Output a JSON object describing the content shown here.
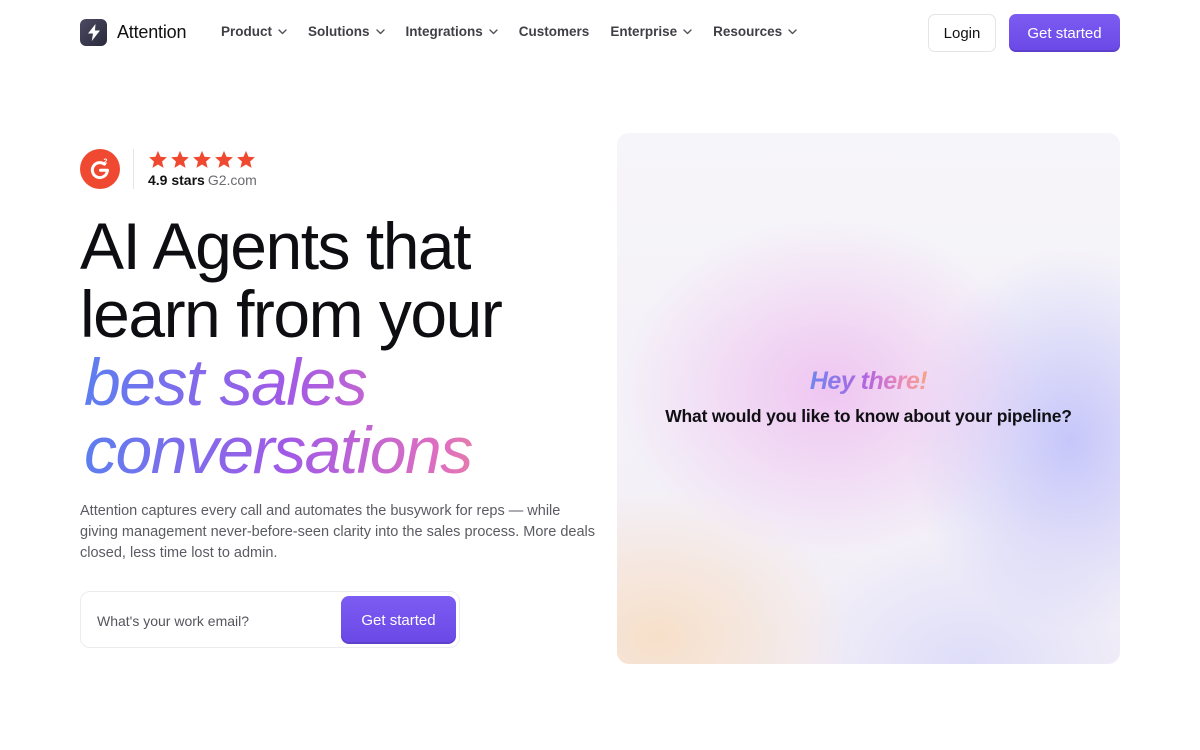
{
  "nav": {
    "brand_name": "Attention",
    "menu": [
      {
        "label": "Product",
        "has_dropdown": true
      },
      {
        "label": "Solutions",
        "has_dropdown": true
      },
      {
        "label": "Integrations",
        "has_dropdown": true
      },
      {
        "label": "Customers",
        "has_dropdown": false
      },
      {
        "label": "Enterprise",
        "has_dropdown": true
      },
      {
        "label": "Resources",
        "has_dropdown": true
      }
    ],
    "login_label": "Login",
    "cta_label": "Get started"
  },
  "rating": {
    "stars": 5,
    "value": "4.9 stars",
    "source": "G2.com",
    "badge_color": "#ef4a31",
    "star_color": "#ef4a31"
  },
  "hero": {
    "headline_line1": "AI Agents that",
    "headline_line2": "learn from your",
    "headline_line3": "best sales",
    "headline_line4": "conversations",
    "description": "Attention captures every call and automates the busywork for reps — while giving management never-before-seen clarity into the sales process. More deals closed, less time lost to admin.",
    "email_placeholder": "What's your work email?",
    "email_button_label": "Get started"
  },
  "chat_card": {
    "greeting": "Hey there!",
    "question": "What would you like to know about your pipeline?"
  },
  "colors": {
    "accent": "#6a48e6",
    "text": "#0e0e12"
  }
}
